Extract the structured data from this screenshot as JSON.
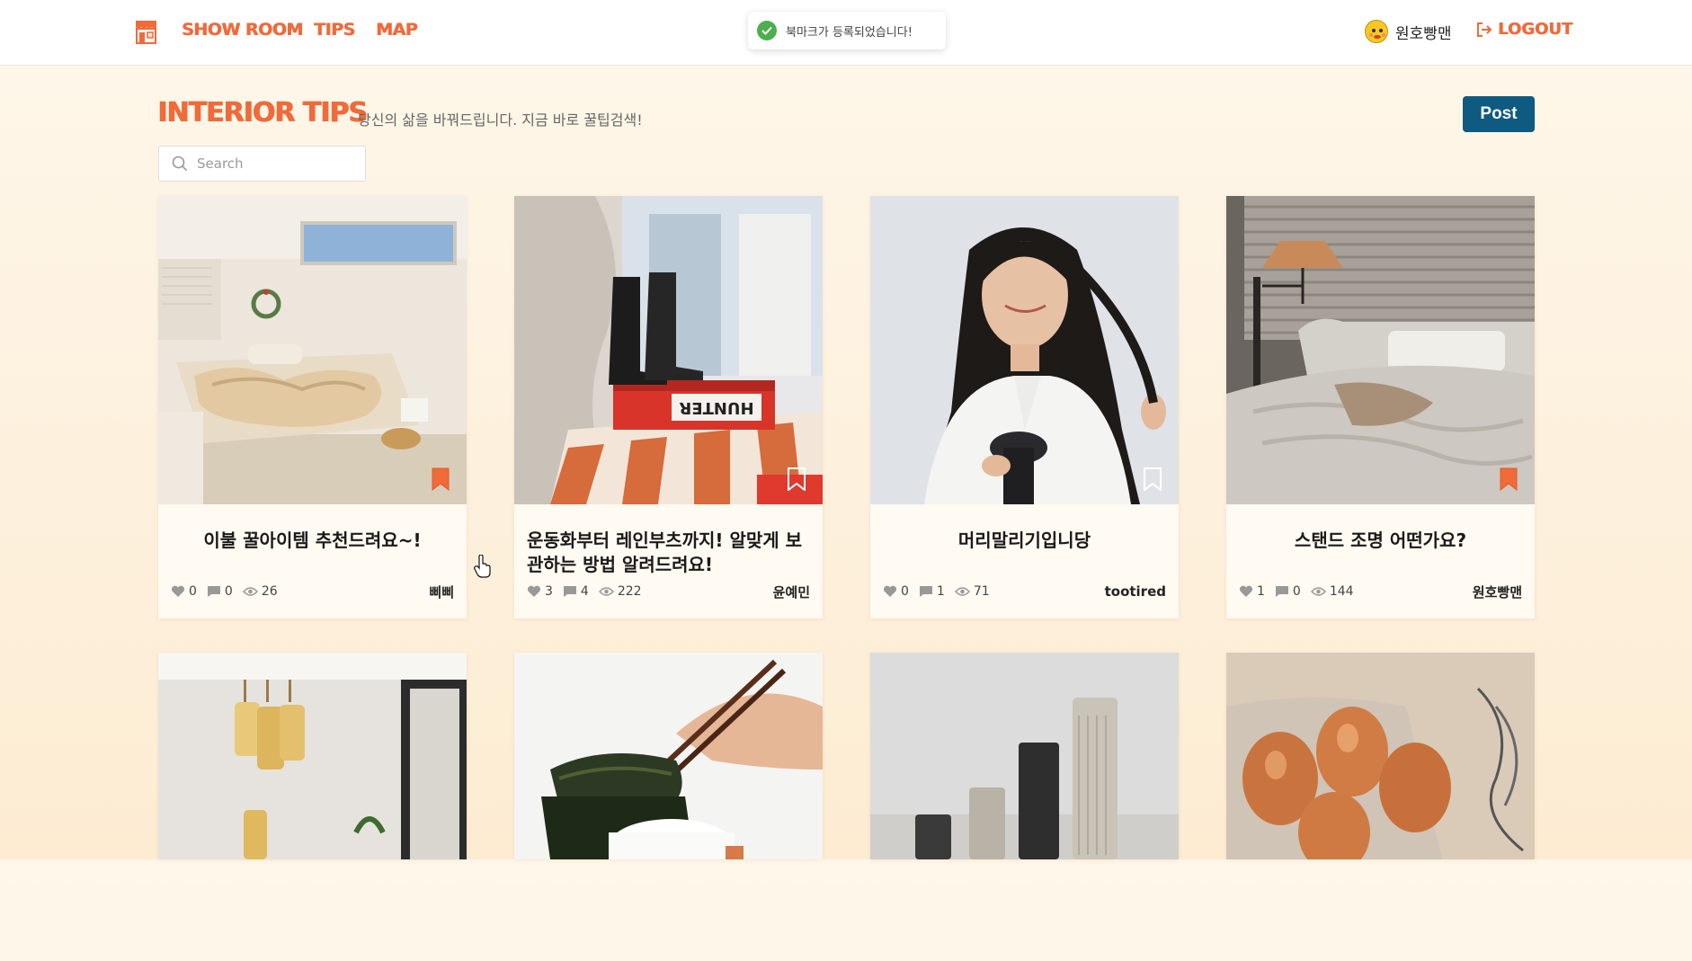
{
  "header": {
    "nav": [
      "SHOW ROOM",
      "TIPS",
      "MAP"
    ],
    "toast": "북마크가 등록되었습니다!",
    "username": "원호빵맨",
    "logout": "LOGOUT",
    "accent_color": "#f06a3a"
  },
  "page": {
    "title": "INTERIOR TIPS",
    "subtitle": "당신의 삶을 바꿔드립니다. 지금 바로 꿀팁검색!",
    "post_label": "Post",
    "search_placeholder": "Search"
  },
  "cards": [
    {
      "title": "이불 꿀아이템 추천드려요~!",
      "likes": "0",
      "comments": "0",
      "views": "26",
      "author": "삐삐",
      "bookmarked": true
    },
    {
      "title": "운동화부터 레인부츠까지! 알맞게 보관하는 방법 알려드려요!",
      "likes": "3",
      "comments": "4",
      "views": "222",
      "author": "윤예민",
      "bookmarked": false
    },
    {
      "title": "머리말리기입니당",
      "likes": "0",
      "comments": "1",
      "views": "71",
      "author": "tootired",
      "bookmarked": false
    },
    {
      "title": "스탠드 조명 어떤가요?",
      "likes": "1",
      "comments": "0",
      "views": "144",
      "author": "원호빵맨",
      "bookmarked": true
    }
  ],
  "image_labels": {
    "card2_box": "HUNTER"
  }
}
